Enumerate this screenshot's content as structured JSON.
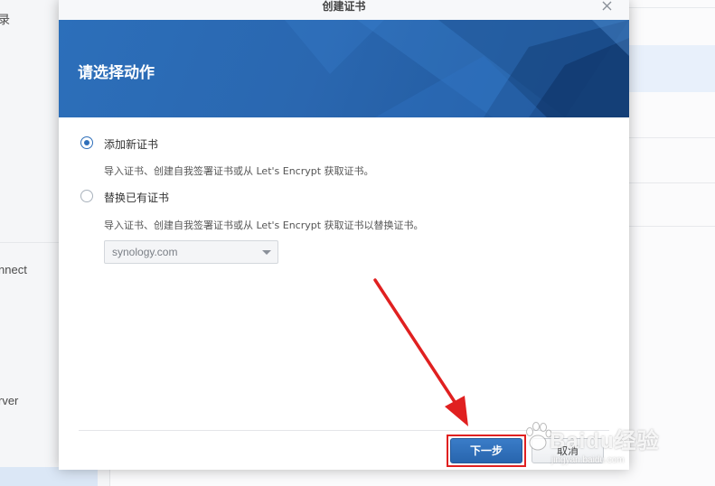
{
  "background": {
    "sidebar_items": [
      "录",
      "nnect",
      "rver"
    ],
    "selected_item_color": "#dbe7f6"
  },
  "dialog": {
    "title": "创建证书",
    "close_icon": "close-icon",
    "banner_title": "请选择动作",
    "options": [
      {
        "label": "添加新证书",
        "description": "导入证书、创建自我签署证书或从 Let's Encrypt 获取证书。",
        "selected": true
      },
      {
        "label": "替换已有证书",
        "description": "导入证书、创建自我签署证书或从 Let's Encrypt 获取证书以替换证书。",
        "selected": false
      }
    ],
    "certificate_select": {
      "value": "synology.com"
    },
    "buttons": {
      "next_label": "下一步",
      "cancel_label": "取消"
    }
  },
  "watermark": {
    "text": "Baidu经验",
    "subtext": "jingyan.baidu.com"
  },
  "colors": {
    "accent": "#2f6fba",
    "banner": "#2a67b0",
    "highlight": "#e02020"
  }
}
